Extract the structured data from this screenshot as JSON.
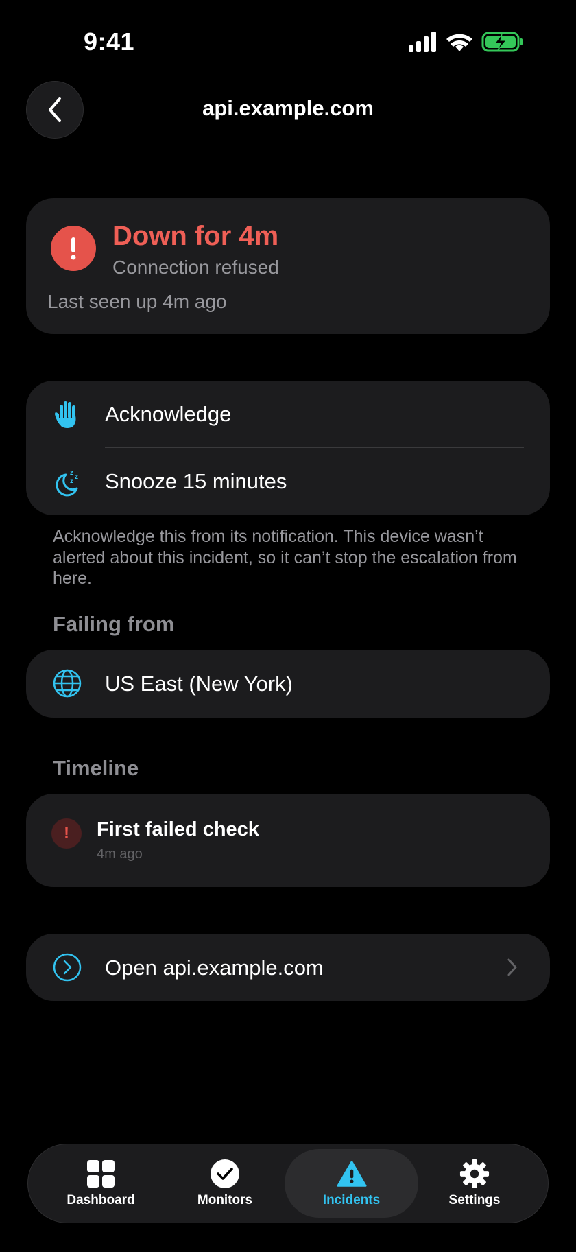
{
  "status_bar": {
    "time": "9:41"
  },
  "nav": {
    "title": "api.example.com"
  },
  "incident": {
    "title": "Down for 4m",
    "subtitle": "Connection refused",
    "last_seen": "Last seen up 4m ago"
  },
  "actions": {
    "acknowledge_label": "Acknowledge",
    "snooze_label": "Snooze 15 minutes",
    "note": "Acknowledge this from its notification. This device wasn’t alerted about this incident, so it can’t stop the escalation from here."
  },
  "failing_from": {
    "heading": "Failing from",
    "region": "US East (New York)"
  },
  "timeline": {
    "heading": "Timeline",
    "events": [
      {
        "title": "First failed check",
        "time": "4m ago"
      }
    ]
  },
  "open_link": {
    "label": "Open api.example.com"
  },
  "tabbar": {
    "tabs": [
      {
        "label": "Dashboard",
        "icon": "grid-icon"
      },
      {
        "label": "Monitors",
        "icon": "checkmark-circle-icon"
      },
      {
        "label": "Incidents",
        "icon": "warning-triangle-icon"
      },
      {
        "label": "Settings",
        "icon": "gear-icon"
      }
    ],
    "active": "Incidents"
  },
  "colors": {
    "background": "#000000",
    "card": "#1c1c1e",
    "accent": "#32c3f0",
    "danger": "#e5534b",
    "secondary_text": "#98989d",
    "battery": "#34c759"
  }
}
